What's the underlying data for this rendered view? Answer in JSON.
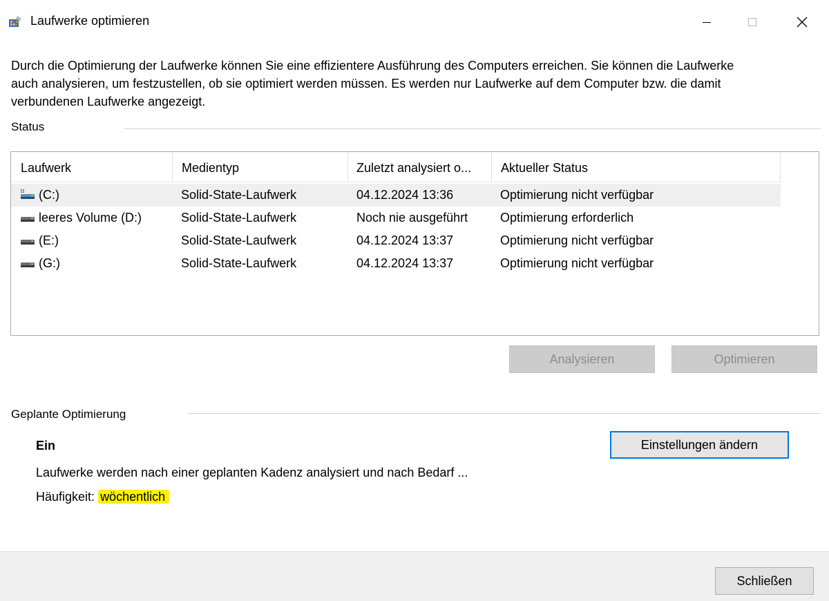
{
  "window": {
    "title": "Laufwerke optimieren",
    "icon": "defrag-app-icon",
    "controls": {
      "minimize": "minimize-icon",
      "maximize": "maximize-icon",
      "close": "close-icon"
    }
  },
  "intro": "Durch die Optimierung der Laufwerke können Sie eine effizientere Ausführung des Computers erreichen. Sie können die Laufwerke auch analysieren, um festzustellen, ob sie optimiert werden müssen. Es werden nur Laufwerke auf dem Computer bzw. die damit verbundenen Laufwerke angezeigt.",
  "status": {
    "label": "Status",
    "columns": [
      "Laufwerk",
      "Medientyp",
      "Zuletzt analysiert o...",
      "Aktueller Status"
    ],
    "rows": [
      {
        "drive": "(C:)",
        "media": "Solid-State-Laufwerk",
        "last": "04.12.2024 13:36",
        "status": "Optimierung nicht verfügbar",
        "icon": "system-drive-icon",
        "selected": true
      },
      {
        "drive": "leeres Volume (D:)",
        "media": "Solid-State-Laufwerk",
        "last": "Noch nie ausgeführt",
        "status": "Optimierung erforderlich",
        "icon": "drive-icon",
        "selected": false
      },
      {
        "drive": "(E:)",
        "media": "Solid-State-Laufwerk",
        "last": "04.12.2024 13:37",
        "status": "Optimierung nicht verfügbar",
        "icon": "drive-icon",
        "selected": false
      },
      {
        "drive": "(G:)",
        "media": "Solid-State-Laufwerk",
        "last": "04.12.2024 13:37",
        "status": "Optimierung nicht verfügbar",
        "icon": "drive-icon",
        "selected": false
      }
    ],
    "analyze_label": "Analysieren",
    "optimize_label": "Optimieren"
  },
  "schedule": {
    "label": "Geplante Optimierung",
    "state": "Ein",
    "description": "Laufwerke werden nach einer geplanten Kadenz analysiert und nach Bedarf ...",
    "frequency_label": "Häufigkeit:",
    "frequency_value": "wöchentlich",
    "change_label": "Einstellungen ändern",
    "highlight_color": "#fdf000"
  },
  "footer": {
    "close_label": "Schließen"
  },
  "colors": {
    "accent": "#0078d7",
    "disabled_button": "#cccccc",
    "footer_bg": "#f0f0f0",
    "selected_row": "#efefef"
  }
}
